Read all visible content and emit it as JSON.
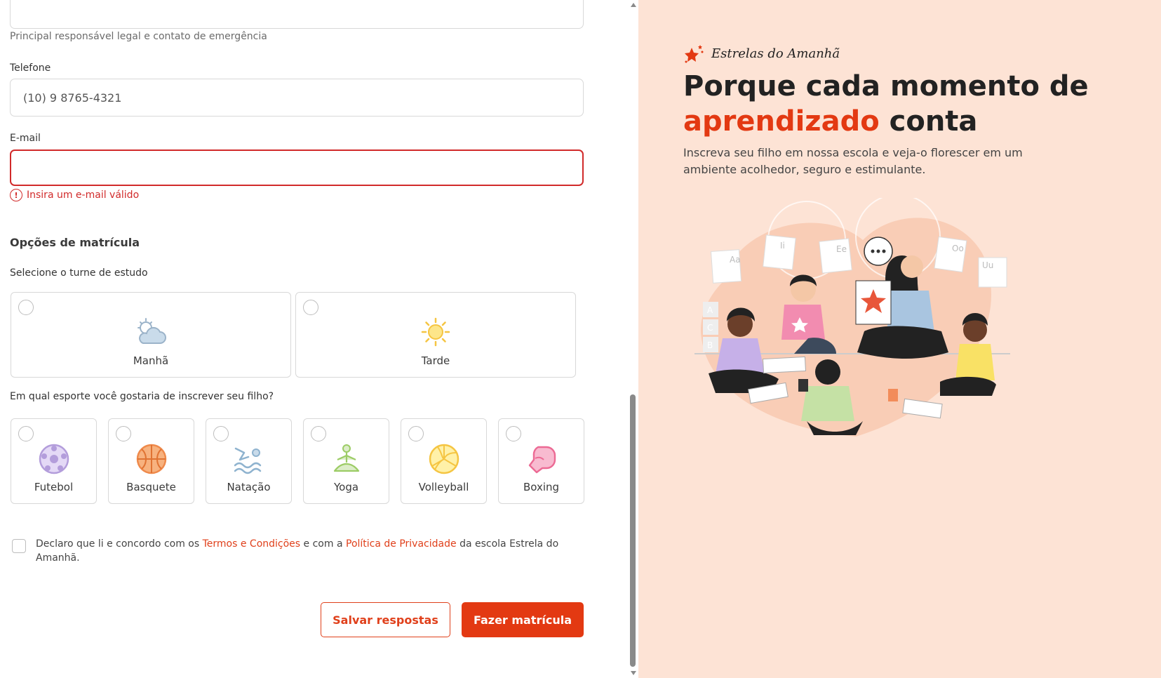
{
  "form": {
    "guardian_helper": "Principal responsável legal e contato de emergência",
    "phone": {
      "label": "Telefone",
      "value": "(10) 9 8765-4321"
    },
    "email": {
      "label": "E-mail",
      "value": "",
      "error": "Insira um e-mail válido"
    },
    "section_title": "Opções de matrícula",
    "shift": {
      "question": "Selecione o turne de estudo",
      "options": [
        {
          "label": "Manhã",
          "icon": "cloud-sun-icon"
        },
        {
          "label": "Tarde",
          "icon": "sun-icon"
        }
      ]
    },
    "sport": {
      "question": "Em qual esporte você gostaria de inscrever seu filho?",
      "options": [
        {
          "label": "Futebol",
          "icon": "soccer-ball-icon",
          "color": "#b39ddb"
        },
        {
          "label": "Basquete",
          "icon": "basketball-icon",
          "color": "#f4a06a"
        },
        {
          "label": "Natação",
          "icon": "swimmer-icon",
          "color": "#8fb3cf"
        },
        {
          "label": "Yoga",
          "icon": "yoga-icon",
          "color": "#9ccc65"
        },
        {
          "label": "Volleyball",
          "icon": "volleyball-icon",
          "color": "#fdd835"
        },
        {
          "label": "Boxing",
          "icon": "boxing-glove-icon",
          "color": "#f06292"
        }
      ]
    },
    "terms": {
      "prefix": "Declaro que li e concordo com os",
      "link1": "Termos e Condições",
      "middle": "e com a",
      "link2": "Política de Privacidade",
      "suffix": "da escola Estrela do Amanhã."
    },
    "buttons": {
      "save": "Salvar respostas",
      "submit": "Fazer matrícula"
    }
  },
  "promo": {
    "brand": "Estrelas do Amanhã",
    "headline_part1": "Porque cada momento de",
    "headline_accent": "aprendizado",
    "headline_part2": "conta",
    "subtitle": "Inscreva seu filho em nossa escola e veja-o florescer em um ambiente acolhedor, seguro e estimulante.",
    "illustration_cards": [
      "Aa",
      "Ii",
      "Ee",
      "Oo",
      "Uu",
      "A",
      "B",
      "C"
    ]
  },
  "colors": {
    "accent": "#e33912",
    "error": "#d12a2a",
    "promo_bg": "#fde3d5"
  }
}
